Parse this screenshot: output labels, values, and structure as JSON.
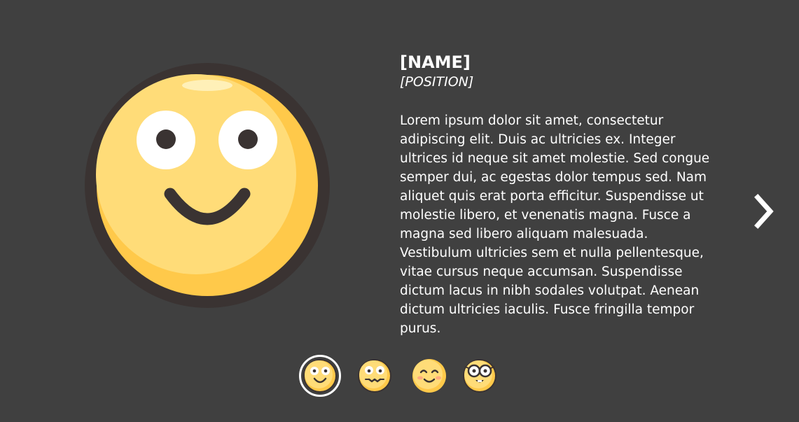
{
  "profile": {
    "name": "[NAME]",
    "position": "[POSITION]",
    "bio": "Lorem ipsum dolor sit amet, consectetur adipiscing elit. Duis ac ultricies ex. Integer ultrices id neque sit amet molestie. Sed congue semper dui, ac egestas dolor tempus sed. Nam aliquet quis erat porta efficitur. Suspendisse ut molestie libero, et venenatis magna. Fusce a magna sed libero aliquam malesuada. Vestibulum ultricies sem et nulla pellentesque, vitae cursus neque accumsan. Suspendisse dictum lacus in nibh sodales volutpat. Aenean dictum ultricies iaculis. Fusce fringilla tempor purus."
  },
  "avatar_icon": "smiling-face-icon",
  "navigation": {
    "next_icon": "chevron-right-icon"
  },
  "thumbnails": [
    {
      "icon": "smiling-face-icon",
      "active": true
    },
    {
      "icon": "blushing-face-icon",
      "active": false
    },
    {
      "icon": "happy-closed-eyes-face-icon",
      "active": false
    },
    {
      "icon": "glasses-face-icon",
      "active": false
    }
  ],
  "colors": {
    "background": "#404040",
    "face_fill": "#ffdc78",
    "face_shade": "#ffc94a",
    "outline": "#3a3332",
    "text": "#ffffff"
  }
}
